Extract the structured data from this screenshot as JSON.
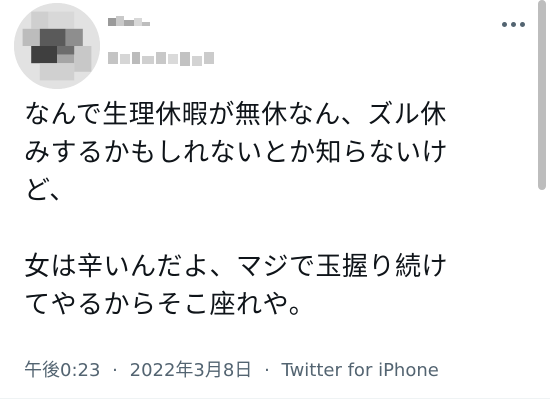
{
  "tweet": {
    "text_lines": [
      "なんで生理休暇が無休なん、ズル休",
      "みするかもしれないとか知らないけ",
      "ど、",
      "",
      "女は辛いんだよ、マジで玉握り続け",
      "てやるからそこ座れや。"
    ],
    "time": "午後0:23",
    "date": "2022年3月8日",
    "separator": "·",
    "source": "Twitter for iPhone"
  },
  "author": {
    "name": "",
    "handle": "",
    "redacted": true
  },
  "colors": {
    "text": "#0f1419",
    "meta": "#536471",
    "background": "#ffffff"
  },
  "icons": {
    "more": "more-horizontal-icon"
  }
}
